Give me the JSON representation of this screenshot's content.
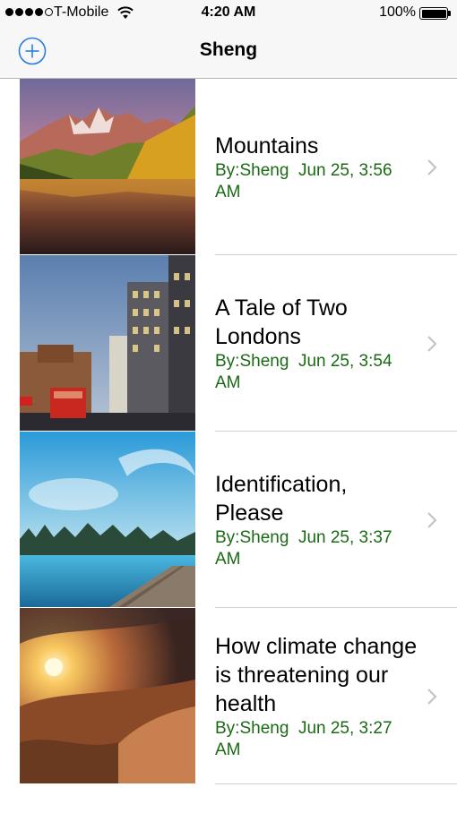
{
  "status_bar": {
    "carrier": "T-Mobile",
    "time": "4:20 AM",
    "battery": "100%"
  },
  "nav": {
    "title": "Sheng"
  },
  "posts": [
    {
      "title": "Mountains",
      "meta": "By:Sheng  Jun 25, 3:56 AM"
    },
    {
      "title": "A Tale of Two Londons",
      "meta": "By:Sheng  Jun 25, 3:54 AM"
    },
    {
      "title": "Identification, Please",
      "meta": "By:Sheng  Jun 25, 3:37 AM"
    },
    {
      "title": "How climate change is threatening our health",
      "meta": "By:Sheng  Jun 25, 3:27 AM"
    }
  ],
  "colors": {
    "accent": "#2a7fe0",
    "meta_text": "#1a6a14"
  }
}
